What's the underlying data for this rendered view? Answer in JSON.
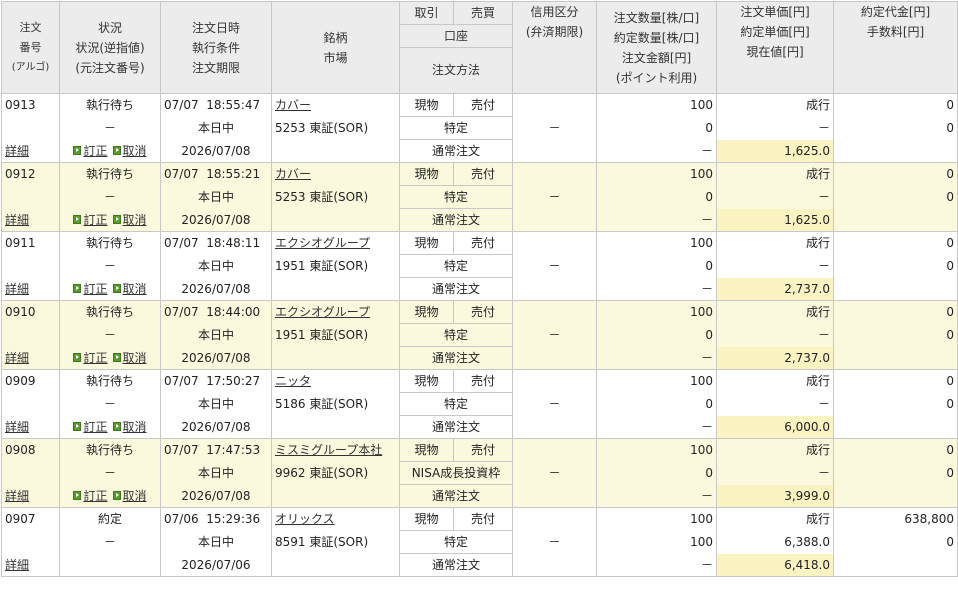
{
  "header": {
    "order_no": [
      "注文",
      "番号",
      "(アルゴ)"
    ],
    "status": [
      "状況",
      "状況(逆指値)",
      "(元注文番号)"
    ],
    "datetime": [
      "注文日時",
      "執行条件",
      "注文期限"
    ],
    "stock": [
      "銘柄",
      "市場"
    ],
    "trade": "取引",
    "buysell": "売買",
    "account": "口座",
    "method": "注文方法",
    "margin": [
      "信用区分",
      "(弁済期限)"
    ],
    "qty": [
      "注文数量[株/口]",
      "約定数量[株/口]",
      "注文金額[円]",
      "(ポイント利用)"
    ],
    "price": [
      "注文単価[円]",
      "約定単価[円]",
      "現在値[円]"
    ],
    "exec_amount": [
      "約定代金[円]",
      "手数料[円]"
    ]
  },
  "links": {
    "detail": "詳細",
    "modify": "訂正",
    "cancel": "取消"
  },
  "orders": [
    {
      "no": "0913",
      "status": "執行待ち",
      "sub_status": "－",
      "date": "07/07",
      "time": "18:55:47",
      "condition": "本日中",
      "expiry": "2026/07/08",
      "name": "カバー",
      "code": "5253",
      "market": "東証(SOR)",
      "trade": "現物",
      "side": "売付",
      "account": "特定",
      "method": "通常注文",
      "margin": "－",
      "order_qty": "100",
      "exec_qty": "0",
      "order_amount": "－",
      "order_price": "成行",
      "exec_price": "－",
      "current_price": "1,625.0",
      "exec_amount": "0",
      "fee": "0",
      "alt": false,
      "actions": true
    },
    {
      "no": "0912",
      "status": "執行待ち",
      "sub_status": "－",
      "date": "07/07",
      "time": "18:55:21",
      "condition": "本日中",
      "expiry": "2026/07/08",
      "name": "カバー",
      "code": "5253",
      "market": "東証(SOR)",
      "trade": "現物",
      "side": "売付",
      "account": "特定",
      "method": "通常注文",
      "margin": "－",
      "order_qty": "100",
      "exec_qty": "0",
      "order_amount": "－",
      "order_price": "成行",
      "exec_price": "－",
      "current_price": "1,625.0",
      "exec_amount": "0",
      "fee": "0",
      "alt": true,
      "actions": true
    },
    {
      "no": "0911",
      "status": "執行待ち",
      "sub_status": "－",
      "date": "07/07",
      "time": "18:48:11",
      "condition": "本日中",
      "expiry": "2026/07/08",
      "name": "エクシオグループ",
      "code": "1951",
      "market": "東証(SOR)",
      "trade": "現物",
      "side": "売付",
      "account": "特定",
      "method": "通常注文",
      "margin": "－",
      "order_qty": "100",
      "exec_qty": "0",
      "order_amount": "－",
      "order_price": "成行",
      "exec_price": "－",
      "current_price": "2,737.0",
      "exec_amount": "0",
      "fee": "0",
      "alt": false,
      "actions": true
    },
    {
      "no": "0910",
      "status": "執行待ち",
      "sub_status": "－",
      "date": "07/07",
      "time": "18:44:00",
      "condition": "本日中",
      "expiry": "2026/07/08",
      "name": "エクシオグループ",
      "code": "1951",
      "market": "東証(SOR)",
      "trade": "現物",
      "side": "売付",
      "account": "特定",
      "method": "通常注文",
      "margin": "－",
      "order_qty": "100",
      "exec_qty": "0",
      "order_amount": "－",
      "order_price": "成行",
      "exec_price": "－",
      "current_price": "2,737.0",
      "exec_amount": "0",
      "fee": "0",
      "alt": true,
      "actions": true
    },
    {
      "no": "0909",
      "status": "執行待ち",
      "sub_status": "－",
      "date": "07/07",
      "time": "17:50:27",
      "condition": "本日中",
      "expiry": "2026/07/08",
      "name": "ニッタ",
      "code": "5186",
      "market": "東証(SOR)",
      "trade": "現物",
      "side": "売付",
      "account": "特定",
      "method": "通常注文",
      "margin": "－",
      "order_qty": "100",
      "exec_qty": "0",
      "order_amount": "－",
      "order_price": "成行",
      "exec_price": "－",
      "current_price": "6,000.0",
      "exec_amount": "0",
      "fee": "0",
      "alt": false,
      "actions": true
    },
    {
      "no": "0908",
      "status": "執行待ち",
      "sub_status": "－",
      "date": "07/07",
      "time": "17:47:53",
      "condition": "本日中",
      "expiry": "2026/07/08",
      "name": "ミスミグループ本社",
      "code": "9962",
      "market": "東証(SOR)",
      "trade": "現物",
      "side": "売付",
      "account": "NISA成長投資枠",
      "method": "通常注文",
      "margin": "－",
      "order_qty": "100",
      "exec_qty": "0",
      "order_amount": "－",
      "order_price": "成行",
      "exec_price": "－",
      "current_price": "3,999.0",
      "exec_amount": "0",
      "fee": "0",
      "alt": true,
      "actions": true
    },
    {
      "no": "0907",
      "status": "約定",
      "sub_status": "－",
      "date": "07/06",
      "time": "15:29:36",
      "condition": "本日中",
      "expiry": "2026/07/06",
      "name": "オリックス",
      "code": "8591",
      "market": "東証(SOR)",
      "trade": "現物",
      "side": "売付",
      "account": "特定",
      "method": "通常注文",
      "margin": "－",
      "order_qty": "100",
      "exec_qty": "100",
      "order_amount": "－",
      "order_price": "成行",
      "exec_price": "6,388.0",
      "current_price": "6,418.0",
      "exec_amount": "638,800",
      "fee": "0",
      "alt": false,
      "actions": false
    }
  ]
}
